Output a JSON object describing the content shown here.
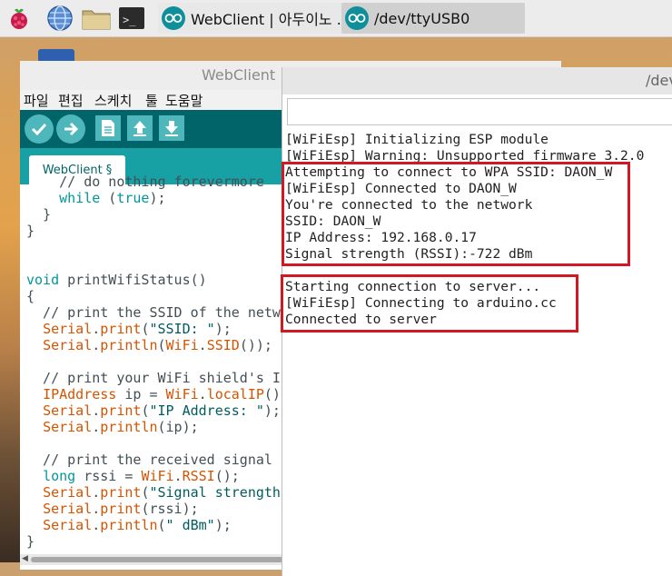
{
  "taskbar": {
    "launchers": [
      "raspberry-menu",
      "web-browser",
      "file-manager",
      "terminal"
    ],
    "terminal_prompt": ">_",
    "tasks": [
      {
        "label": "WebClient | 아두이노 ..."
      },
      {
        "label": "/dev/ttyUSB0"
      }
    ]
  },
  "ide": {
    "title": "WebClient | C",
    "menu": [
      "파일",
      "편집",
      "스케치",
      "툴",
      "도움말"
    ],
    "toolbar": [
      "verify",
      "upload",
      "new",
      "open",
      "save"
    ],
    "tab_label": "WebClient §",
    "code_lines": [
      [
        [
          "cm",
          "    // do nothing forevermore"
        ]
      ],
      [
        [
          "t",
          "    "
        ],
        [
          "kw",
          "while"
        ],
        [
          "t",
          " ("
        ],
        [
          "kw",
          "true"
        ],
        [
          "t",
          ");"
        ]
      ],
      [
        [
          "t",
          "  }"
        ]
      ],
      [
        [
          "t",
          "}"
        ]
      ],
      [
        [
          "t",
          ""
        ]
      ],
      [
        [
          "t",
          ""
        ]
      ],
      [
        [
          "kw",
          "void"
        ],
        [
          "t",
          " printWifiStatus()"
        ]
      ],
      [
        [
          "t",
          "{"
        ]
      ],
      [
        [
          "cm",
          "  // print the SSID of the netw"
        ]
      ],
      [
        [
          "t",
          "  "
        ],
        [
          "cl",
          "Serial"
        ],
        [
          "t",
          "."
        ],
        [
          "cl",
          "print"
        ],
        [
          "t",
          "("
        ],
        [
          "st",
          "\"SSID: \""
        ],
        [
          "t",
          ");"
        ]
      ],
      [
        [
          "t",
          "  "
        ],
        [
          "cl",
          "Serial"
        ],
        [
          "t",
          "."
        ],
        [
          "cl",
          "println"
        ],
        [
          "t",
          "("
        ],
        [
          "cl",
          "WiFi"
        ],
        [
          "t",
          "."
        ],
        [
          "cl",
          "SSID"
        ],
        [
          "t",
          "());"
        ]
      ],
      [
        [
          "t",
          ""
        ]
      ],
      [
        [
          "cm",
          "  // print your WiFi shield's IP"
        ]
      ],
      [
        [
          "t",
          "  "
        ],
        [
          "cl",
          "IPAddress"
        ],
        [
          "t",
          " ip = "
        ],
        [
          "cl",
          "WiFi"
        ],
        [
          "t",
          "."
        ],
        [
          "cl",
          "localIP"
        ],
        [
          "t",
          "()"
        ]
      ],
      [
        [
          "t",
          "  "
        ],
        [
          "cl",
          "Serial"
        ],
        [
          "t",
          "."
        ],
        [
          "cl",
          "print"
        ],
        [
          "t",
          "("
        ],
        [
          "st",
          "\"IP Address: \""
        ],
        [
          "t",
          ");"
        ]
      ],
      [
        [
          "t",
          "  "
        ],
        [
          "cl",
          "Serial"
        ],
        [
          "t",
          "."
        ],
        [
          "cl",
          "println"
        ],
        [
          "t",
          "(ip);"
        ]
      ],
      [
        [
          "t",
          ""
        ]
      ],
      [
        [
          "cm",
          "  // print the received signal s"
        ]
      ],
      [
        [
          "t",
          "  "
        ],
        [
          "kw",
          "long"
        ],
        [
          "t",
          " rssi = "
        ],
        [
          "cl",
          "WiFi"
        ],
        [
          "t",
          "."
        ],
        [
          "cl",
          "RSSI"
        ],
        [
          "t",
          "();"
        ]
      ],
      [
        [
          "t",
          "  "
        ],
        [
          "cl",
          "Serial"
        ],
        [
          "t",
          "."
        ],
        [
          "cl",
          "print"
        ],
        [
          "t",
          "("
        ],
        [
          "st",
          "\"Signal strength"
        ]
      ],
      [
        [
          "t",
          "  "
        ],
        [
          "cl",
          "Serial"
        ],
        [
          "t",
          "."
        ],
        [
          "cl",
          "print"
        ],
        [
          "t",
          "(rssi);"
        ]
      ],
      [
        [
          "t",
          "  "
        ],
        [
          "cl",
          "Serial"
        ],
        [
          "t",
          "."
        ],
        [
          "cl",
          "println"
        ],
        [
          "t",
          "("
        ],
        [
          "st",
          "\" dBm\""
        ],
        [
          "t",
          ");"
        ]
      ],
      [
        [
          "t",
          "}"
        ]
      ]
    ]
  },
  "serial": {
    "title": "/dev",
    "input_value": "",
    "lines": [
      "[WiFiEsp] Initializing ESP module",
      "[WiFiEsp] Warning: Unsupported firmware 3.2.0",
      "Attempting to connect to WPA SSID: DAON_W",
      "[WiFiEsp] Connected to DAON_W",
      "You're connected to the network",
      "SSID: DAON_W",
      "IP Address: 192.168.0.17",
      "Signal strength (RSSI):-722 dBm",
      "",
      "Starting connection to server...",
      "[WiFiEsp] Connecting to arduino.cc",
      "Connected to server"
    ]
  },
  "colors": {
    "highlight_box": "#d01a23",
    "ide_toolbar": "#006468",
    "ide_tabstrip": "#17a1a5",
    "ide_buttons": "#4db7bb"
  }
}
